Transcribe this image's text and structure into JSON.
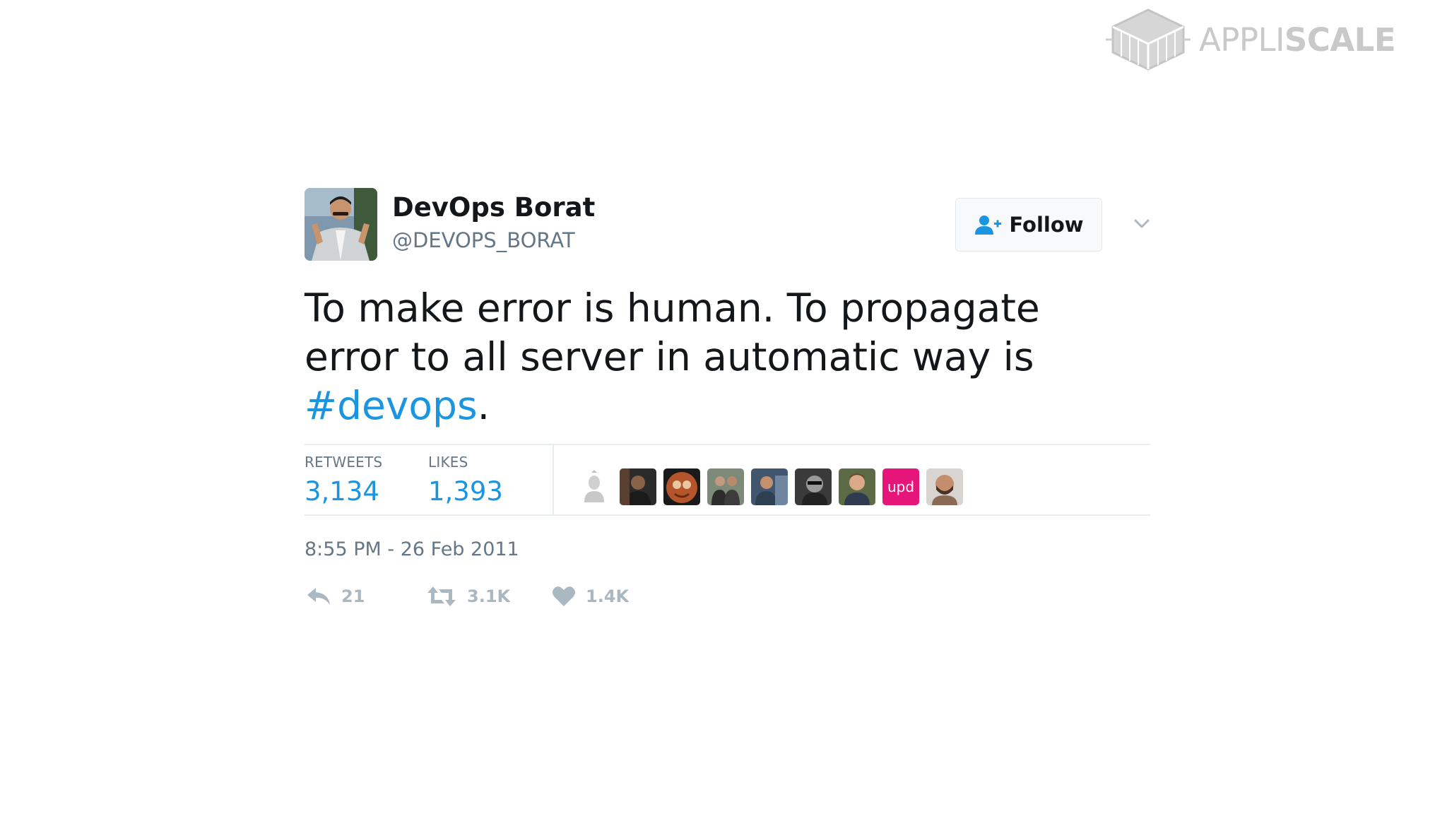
{
  "brand": {
    "name_light": "APPLI",
    "name_bold": "SCALE",
    "logo_icon": "isometric-box-logo-icon",
    "color": "#c9c9c9"
  },
  "tweet": {
    "author": {
      "display_name": "DevOps Borat",
      "handle": "@DEVOPS_BORAT",
      "avatar_icon": "profile-photo"
    },
    "follow": {
      "label": "Follow",
      "icon": "add-user-icon"
    },
    "menu_icon": "chevron-down-icon",
    "text": {
      "line1": "To make error is human. To propagate",
      "line2": "error to all server in automatic way is",
      "hashtag": "#devops",
      "trailing": "."
    },
    "stats": {
      "retweets_label": "RETWEETS",
      "retweets_value": "3,134",
      "likes_label": "LIKES",
      "likes_value": "1,393"
    },
    "likers": [
      {
        "icon": "default-egg-avatar",
        "color": "#e8e8e8"
      },
      {
        "icon": "user-avatar",
        "color": "#2b2b2b"
      },
      {
        "icon": "user-avatar",
        "color": "#b5552b"
      },
      {
        "icon": "user-avatar",
        "color": "#4a4a4a"
      },
      {
        "icon": "user-avatar",
        "color": "#41566e"
      },
      {
        "icon": "user-avatar",
        "color": "#3a3a3a"
      },
      {
        "icon": "user-avatar",
        "color": "#5c6b45"
      },
      {
        "icon": "upd-logo-avatar",
        "color": "#e5157a",
        "text": "upd"
      },
      {
        "icon": "user-avatar",
        "color": "#8a6a55"
      }
    ],
    "timestamp": "8:55 PM - 26 Feb 2011",
    "actions": {
      "reply_count": "21",
      "retweet_count": "3.1K",
      "like_count": "1.4K"
    },
    "colors": {
      "link": "#1b95e0",
      "muted": "#657786",
      "action_gray": "#aab8c2",
      "text": "#14171a"
    }
  }
}
